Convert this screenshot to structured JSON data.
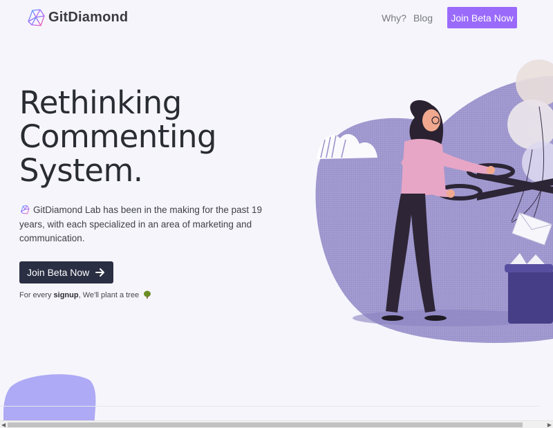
{
  "brand": {
    "name": "GitDiamond",
    "logo_icon": "diamond-icon",
    "accent": "#9a6bfb"
  },
  "nav": {
    "links": [
      "Why?",
      "Blog"
    ],
    "cta": "Join Beta Now"
  },
  "hero": {
    "headline": [
      "Rethinking",
      "Commenting",
      "System."
    ],
    "description": "GitDiamond Lab has been in the making for the past 19 years, with each specialized in an area of marketing and communication.",
    "cta": "Join Beta Now",
    "cta_icon": "arrow-right-icon",
    "note_prefix": "For every ",
    "note_bold": "signup",
    "note_suffix": ", We'll plant a tree",
    "note_icon": "tree-icon"
  },
  "colors": {
    "dark_button": "#2b2f44",
    "blob": "#9b93cc",
    "page_bg": "#f6f5fc"
  }
}
